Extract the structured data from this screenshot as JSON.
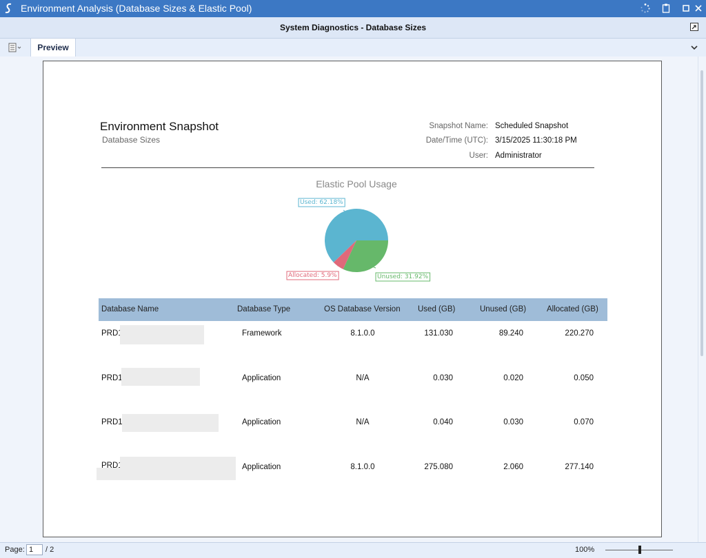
{
  "window": {
    "title": "Environment Analysis (Database Sizes & Elastic Pool)",
    "subheader": "System Diagnostics - Database Sizes",
    "icons": [
      "app-logo-icon",
      "loading-spinner-icon",
      "clipboard-icon",
      "maximize-icon",
      "close-icon",
      "popout-icon"
    ]
  },
  "tabs": {
    "active": "Preview",
    "menu_icon": "report-menu-icon",
    "chevron_icon": "chevron-down-icon"
  },
  "report": {
    "title": "Environment Snapshot",
    "subtitle": "Database Sizes",
    "meta": [
      {
        "label": "Snapshot Name:",
        "value": "Scheduled Snapshot"
      },
      {
        "label": "Date/Time (UTC):",
        "value": "3/15/2025 11:30:18 PM"
      },
      {
        "label": "User:",
        "value": "Administrator"
      }
    ],
    "chart_title": "Elastic Pool Usage",
    "table": {
      "headers": [
        "Database Name",
        "Database Type",
        "OS Database Version",
        "Used (GB)",
        "Unused (GB)",
        "Allocated (GB)"
      ],
      "rows": [
        {
          "name": "PRD1",
          "type": "Framework",
          "version": "8.1.0.0",
          "used": "131.030",
          "unused": "89.240",
          "allocated": "220.270"
        },
        {
          "name": "PRD1",
          "type": "Application",
          "version": "N/A",
          "used": "0.030",
          "unused": "0.020",
          "allocated": "0.050"
        },
        {
          "name": "PRD1",
          "type": "Application",
          "version": "N/A",
          "used": "0.040",
          "unused": "0.030",
          "allocated": "0.070"
        },
        {
          "name": "PRD1",
          "type": "Application",
          "version": "8.1.0.0",
          "used": "275.080",
          "unused": "2.060",
          "allocated": "277.140"
        }
      ]
    }
  },
  "chart_data": {
    "type": "pie",
    "title": "Elastic Pool Usage",
    "slices": [
      {
        "label": "Used: 62.18%",
        "value": 62.18,
        "color": "#5bb5d0"
      },
      {
        "label": "Unused: 31.92%",
        "value": 31.92,
        "color": "#66b86a"
      },
      {
        "label": "Allocated: 5.9%",
        "value": 5.9,
        "color": "#e0697a"
      }
    ]
  },
  "status": {
    "page_label": "Page:",
    "page_value": "1",
    "page_total": "/ 2",
    "zoom": "100%"
  },
  "colors": {
    "titlebar": "#3c78c4",
    "table_header": "#9fbcd8"
  }
}
